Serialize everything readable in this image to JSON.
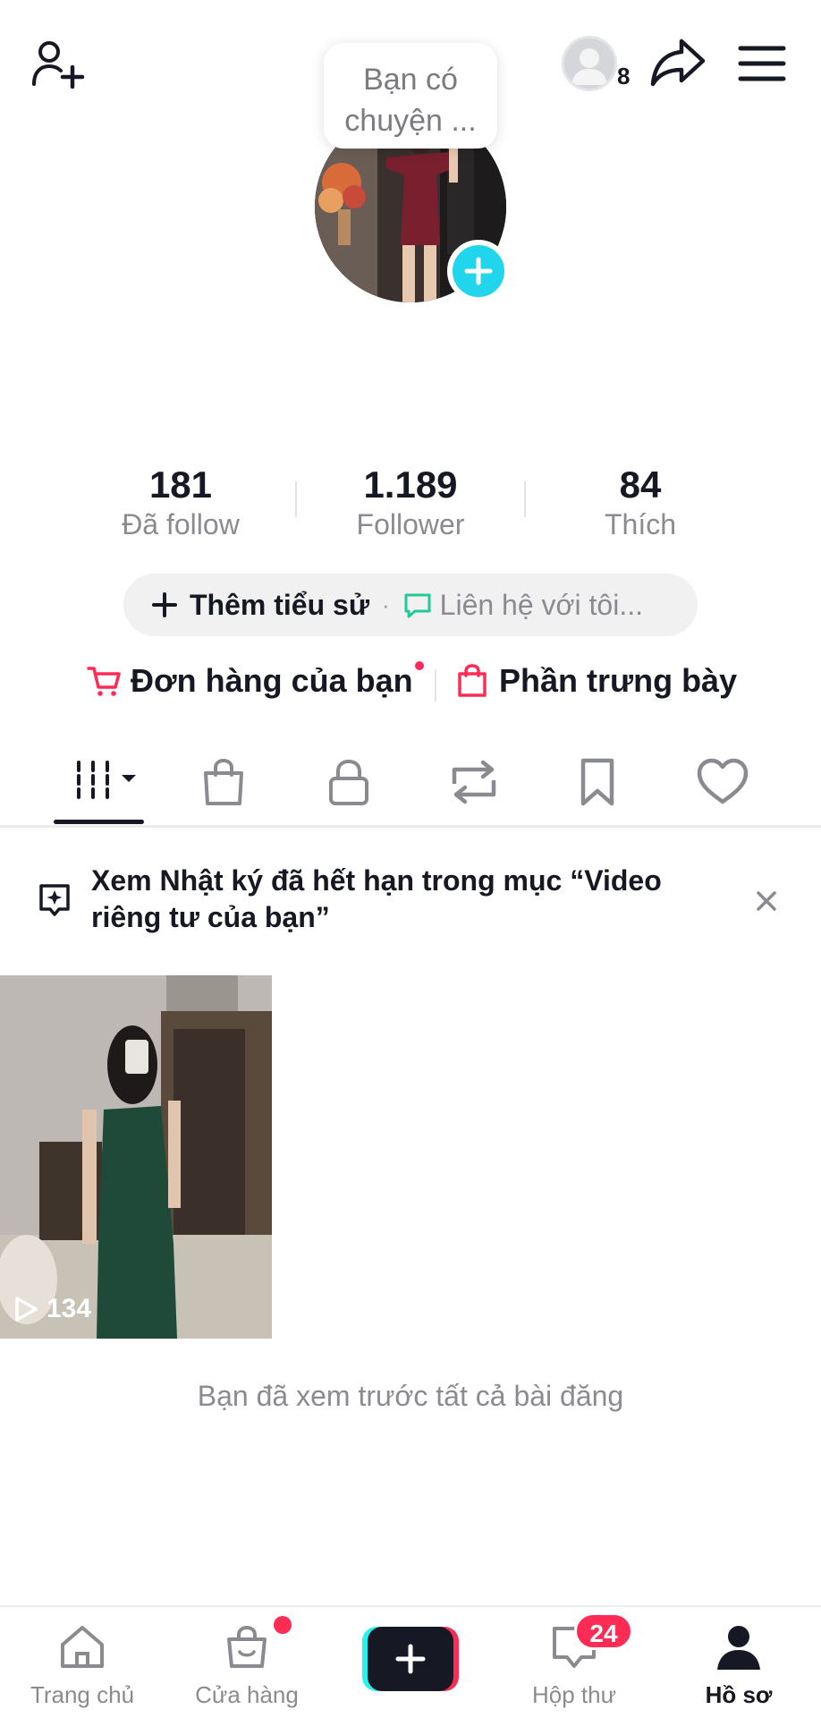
{
  "header": {
    "visitor_count": "8",
    "bubble_text_line1": "Bạn có",
    "bubble_text_line2": "chuyện ..."
  },
  "stats": [
    {
      "value": "181",
      "label": "Đã follow"
    },
    {
      "value": "1.189",
      "label": "Follower"
    },
    {
      "value": "84",
      "label": "Thích"
    }
  ],
  "bio": {
    "add_label": "Thêm tiểu sử",
    "separator": "·",
    "contact_label": "Liên hệ với tôi..."
  },
  "shop": {
    "orders_label": "Đơn hàng của bạn",
    "showcase_label": "Phần trưng bày"
  },
  "tabs": [
    "videos-grid",
    "shop-bag",
    "private-lock",
    "reposts",
    "saved",
    "liked"
  ],
  "banner": {
    "text": "Xem Nhật ký đã hết hạn trong mục “Video riêng tư của bạn”"
  },
  "videos": [
    {
      "views": "134"
    }
  ],
  "end_message": "Bạn đã xem trước tất cả bài đăng",
  "bottom_nav": {
    "home": "Trang chủ",
    "shop": "Cửa hàng",
    "inbox": "Hộp thư",
    "inbox_badge": "24",
    "profile": "Hồ sơ"
  },
  "colors": {
    "accent_red": "#fe2c55",
    "accent_cyan": "#20d5ec",
    "text_primary": "#161823",
    "text_secondary": "#8a8b91"
  }
}
